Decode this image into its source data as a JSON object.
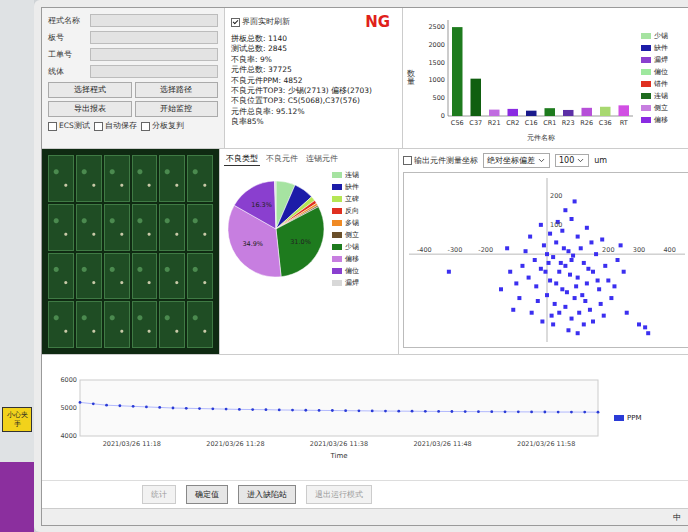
{
  "sticker": {
    "text": "小心夹手"
  },
  "form": {
    "fields": [
      {
        "label": "程式名称",
        "value": ""
      },
      {
        "label": "板号",
        "value": ""
      },
      {
        "label": "工单号",
        "value": ""
      },
      {
        "label": "线体",
        "value": ""
      }
    ],
    "buttons": [
      {
        "label": "选择程式"
      },
      {
        "label": "选择路径"
      },
      {
        "label": "导出报表"
      },
      {
        "label": "开始监控"
      }
    ],
    "checkboxes": [
      {
        "label": "ECS测试",
        "checked": false
      },
      {
        "label": "自动保存",
        "checked": false
      },
      {
        "label": "分板复判",
        "checked": false
      }
    ]
  },
  "stats": {
    "title": "界面实时刷新",
    "checked": true,
    "status": "NG",
    "lines": [
      "拼板总数: 1140",
      "测试总数: 2845",
      "不良率: 9%",
      "元件总数: 37725",
      "不良元件PPM: 4852",
      "不良元件TOP3: 少锡(2713) 偏移(2703)",
      "不良位置TOP3: C5(5068),C37(576)",
      "元件总良率: 95.12%",
      "良率85%"
    ]
  },
  "bar_chart": {
    "y_label": "数量",
    "x_label": "元件名称",
    "max": 2700,
    "y_ticks": [
      {
        "value": 0,
        "label": "0"
      },
      {
        "value": 500,
        "label": "500"
      },
      {
        "value": 1000,
        "label": "1000"
      },
      {
        "value": 1500,
        "label": "1500"
      },
      {
        "value": 2000,
        "label": "2000"
      },
      {
        "value": 2500,
        "label": "2500"
      }
    ],
    "bars": [
      {
        "label": "C56",
        "value": 2500,
        "color": "#1e7b1e"
      },
      {
        "label": "C37",
        "value": 1050,
        "color": "#0f5f0f"
      },
      {
        "label": "R21",
        "value": 180,
        "color": "#c06be0"
      },
      {
        "label": "CR2",
        "value": 200,
        "color": "#8a2be2"
      },
      {
        "label": "C16",
        "value": 150,
        "color": "#1a1a8c"
      },
      {
        "label": "CR1",
        "value": 220,
        "color": "#1e7b1e"
      },
      {
        "label": "R23",
        "value": 170,
        "color": "#5c2fa6"
      },
      {
        "label": "R26",
        "value": 230,
        "color": "#b64fd8"
      },
      {
        "label": "C36",
        "value": 260,
        "color": "#a8d870"
      },
      {
        "label": "RT",
        "value": 300,
        "color": "#d14fe3"
      }
    ],
    "legend": [
      {
        "label": "少锡",
        "color": "#a6e3a1"
      },
      {
        "label": "缺件",
        "color": "#1c1ca8"
      },
      {
        "label": "漏焊",
        "color": "#8a3fcf"
      },
      {
        "label": "偏位",
        "color": "#9ee89e"
      },
      {
        "label": "错件",
        "color": "#e03020"
      },
      {
        "label": "连锡",
        "color": "#1e6b1e"
      },
      {
        "label": "侧立",
        "color": "#c77ee0"
      },
      {
        "label": "偏移",
        "color": "#8a2be2"
      }
    ]
  },
  "pie": {
    "tabs": [
      {
        "label": "不良类型",
        "selected": true
      },
      {
        "label": "不良元件",
        "selected": false
      },
      {
        "label": "连锡元件",
        "selected": false
      }
    ],
    "slices": [
      {
        "label": "连锡",
        "value": 6.5,
        "color": "#a6e3a1"
      },
      {
        "label": "缺件",
        "value": 6.8,
        "color": "#1c1ca8"
      },
      {
        "label": "立碑",
        "value": 1.6,
        "color": "#b5e655"
      },
      {
        "label": "反向",
        "value": 1.1,
        "color": "#e03020"
      },
      {
        "label": "多锡",
        "value": 0.8,
        "color": "#f08a24"
      },
      {
        "label": "侧立",
        "value": 0.5,
        "color": "#6a4f2a"
      },
      {
        "label": "少锡",
        "value": 31.0,
        "color": "#1e7b1e",
        "reading": "31.0%"
      },
      {
        "label": "偏移",
        "value": 34.9,
        "color": "#c77ee0",
        "reading": "34.9%"
      },
      {
        "label": "偏位",
        "value": 16.3,
        "color": "#8a3fcf",
        "reading": "16.3%"
      },
      {
        "label": "漏焊",
        "value": 0.5,
        "color": "#d8d8d8"
      }
    ]
  },
  "scatter": {
    "checkbox": {
      "label": "输出元件测量坐标",
      "checked": false
    },
    "mode": "绝对坐标偏差",
    "range": "100",
    "unit": "um",
    "color": "#3b2ff0",
    "x_ticks": [
      {
        "value": -400,
        "label": "-400"
      },
      {
        "value": -300,
        "label": "-300"
      },
      {
        "value": -200,
        "label": "-200"
      },
      {
        "value": 200,
        "label": "200"
      },
      {
        "value": 300,
        "label": "300"
      },
      {
        "value": 400,
        "label": "400"
      }
    ],
    "y_ticks": [
      {
        "value": 200,
        "label": "200"
      },
      {
        "value": 100,
        "label": "100"
      }
    ],
    "points": [
      [
        60,
        -40
      ],
      [
        80,
        -20
      ],
      [
        40,
        -60
      ],
      [
        100,
        -80
      ],
      [
        20,
        -10
      ],
      [
        120,
        -30
      ],
      [
        -20,
        -50
      ],
      [
        70,
        10
      ],
      [
        50,
        -120
      ],
      [
        90,
        -150
      ],
      [
        130,
        -100
      ],
      [
        10,
        -90
      ],
      [
        -40,
        -20
      ],
      [
        150,
        -60
      ],
      [
        30,
        40
      ],
      [
        110,
        20
      ],
      [
        -60,
        -80
      ],
      [
        170,
        -120
      ],
      [
        0,
        -140
      ],
      [
        60,
        -180
      ],
      [
        140,
        -190
      ],
      [
        -30,
        -160
      ],
      [
        80,
        -220
      ],
      [
        20,
        -240
      ],
      [
        100,
        60
      ],
      [
        50,
        80
      ],
      [
        -10,
        30
      ],
      [
        160,
        0
      ],
      [
        190,
        -40
      ],
      [
        -80,
        -40
      ],
      [
        -100,
        -100
      ],
      [
        200,
        -90
      ],
      [
        40,
        -200
      ],
      [
        120,
        -240
      ],
      [
        -50,
        -200
      ],
      [
        70,
        -260
      ],
      [
        10,
        70
      ],
      [
        130,
        90
      ],
      [
        -20,
        100
      ],
      [
        80,
        120
      ],
      [
        180,
        50
      ],
      [
        210,
        -150
      ],
      [
        -120,
        -60
      ],
      [
        -70,
        10
      ],
      [
        230,
        -20
      ],
      [
        -90,
        -150
      ],
      [
        150,
        -230
      ],
      [
        0,
        0
      ],
      [
        60,
        150
      ],
      [
        100,
        -270
      ],
      [
        30,
        -100
      ],
      [
        75,
        -70
      ],
      [
        95,
        -110
      ],
      [
        45,
        -30
      ],
      [
        115,
        -140
      ],
      [
        -5,
        -60
      ],
      [
        25,
        -170
      ],
      [
        165,
        -90
      ],
      [
        55,
        20
      ],
      [
        85,
        -5
      ],
      [
        135,
        -50
      ],
      [
        -35,
        -110
      ],
      [
        105,
        -200
      ],
      [
        15,
        -210
      ],
      [
        175,
        -170
      ],
      [
        -55,
        60
      ],
      [
        35,
        110
      ],
      [
        -150,
        -120
      ],
      [
        250,
        -60
      ],
      [
        240,
        30
      ],
      [
        -130,
        20
      ],
      [
        65,
        -130
      ],
      [
        125,
        -160
      ],
      [
        5,
        -30
      ],
      [
        145,
        40
      ],
      [
        -15,
        -230
      ],
      [
        185,
        -210
      ],
      [
        90,
        180
      ],
      [
        -110,
        -190
      ],
      [
        220,
        -110
      ],
      [
        320,
        -250
      ],
      [
        330,
        -270
      ],
      [
        300,
        -240
      ],
      [
        -320,
        -60
      ],
      [
        260,
        -200
      ]
    ]
  },
  "timeline": {
    "x_label": "Time",
    "legend": "PPM",
    "y_min": 4000,
    "y_max": 6000,
    "y_ticks": [
      {
        "value": 6000,
        "label": "6000"
      },
      {
        "value": 5000,
        "label": "5000"
      },
      {
        "value": 4000,
        "label": "4000"
      }
    ],
    "times": [
      "2021/03/26 11:18",
      "2021/03/26 11:28",
      "2021/03/26 11:38",
      "2021/03/26 11:48",
      "2021/03/26 11:58"
    ],
    "values": [
      5200,
      5150,
      5100,
      5080,
      5060,
      5040,
      5020,
      5000,
      4990,
      4980,
      4970,
      4960,
      4950,
      4945,
      4940,
      4930,
      4925,
      4920,
      4915,
      4910,
      4905,
      4900,
      4895,
      4890,
      4888,
      4885,
      4880,
      4878,
      4875,
      4872,
      4870,
      4868,
      4865,
      4862,
      4860,
      4858,
      4856,
      4855,
      4853,
      4852
    ]
  },
  "buttons": [
    {
      "label": "统计",
      "disabled": true
    },
    {
      "label": "确定值",
      "disabled": false
    },
    {
      "label": "进入缺陷站",
      "disabled": false
    },
    {
      "label": "退出运行模式",
      "disabled": true
    }
  ],
  "taskbar": {
    "ime": "中"
  }
}
